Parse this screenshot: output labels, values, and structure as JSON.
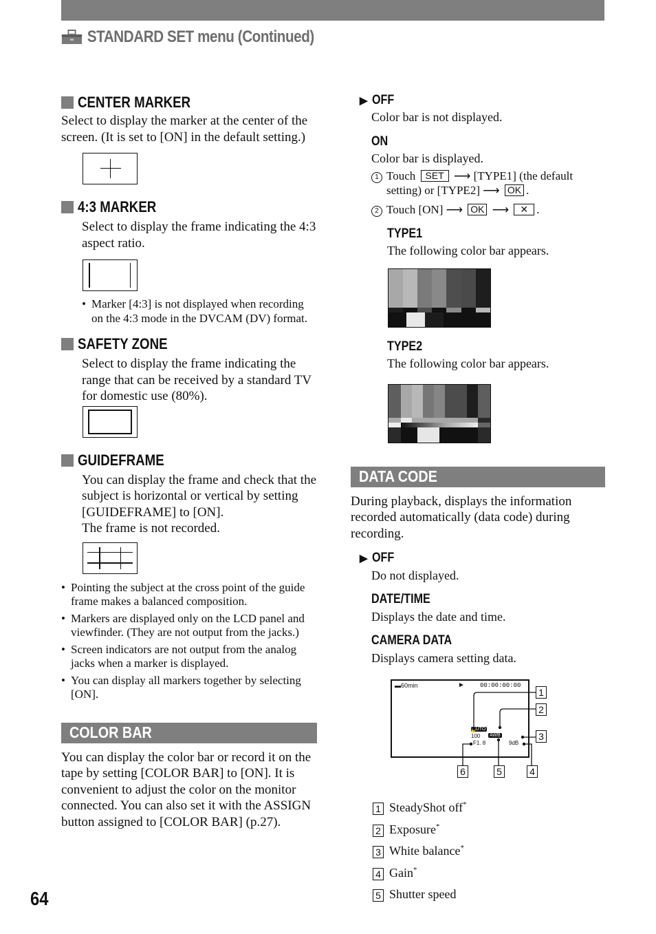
{
  "header": {
    "title": "STANDARD SET menu (Continued)",
    "icon": "toolbox-icon"
  },
  "page_number": "64",
  "left": {
    "center_marker": {
      "heading": "CENTER MARKER",
      "text": "Select to display the marker at the center of the screen. (It is set to [ON] in the default setting.)"
    },
    "marker_43": {
      "heading": "4:3 MARKER",
      "text": "Select to display the frame indicating the 4:3 aspect ratio.",
      "note": "Marker [4:3] is not displayed when recording on the 4:3 mode in the DVCAM (DV) format."
    },
    "safety_zone": {
      "heading": "SAFETY ZONE",
      "text": "Select to display the frame indicating the range that can be received by a standard TV for domestic use (80%)."
    },
    "guideframe": {
      "heading": "GUIDEFRAME",
      "text1": "You can display the frame and check that the subject is horizontal or vertical by setting [GUIDEFRAME] to [ON].",
      "text2": "The frame is not recorded.",
      "notes": [
        "Pointing the subject at the cross point of the guide frame makes a balanced composition.",
        "Markers are displayed only on the LCD panel and viewfinder. (They are not output from the jacks.)",
        "Screen indicators are not output from the analog jacks when a marker is displayed.",
        "You can display all markers together by selecting [ON]."
      ]
    },
    "color_bar": {
      "heading": "COLOR BAR",
      "text": "You can display the color bar or record it on the tape by setting [COLOR BAR] to [ON]. It is convenient to adjust the color on the monitor connected. You can also set it with the ASSIGN button assigned to [COLOR BAR] (p.27)."
    }
  },
  "right": {
    "off": {
      "label": "OFF",
      "desc": "Color bar is not displayed."
    },
    "on": {
      "label": "ON",
      "desc": "Color bar is displayed.",
      "step1": {
        "num": "1",
        "a": "Touch",
        "btn": "SET",
        "b": "[TYPE1] (the default",
        "c": "setting) or [TYPE2]",
        "ok": "OK"
      },
      "step2": {
        "num": "2",
        "a": "Touch [ON]",
        "ok": "OK",
        "close": "✕"
      }
    },
    "type1": {
      "label": "TYPE1",
      "desc": "The following color bar appears."
    },
    "type2": {
      "label": "TYPE2",
      "desc": "The following color bar appears."
    },
    "data_code": {
      "heading": "DATA CODE",
      "text": "During playback, displays the information recorded automatically (data code) during recording.",
      "off": {
        "label": "OFF",
        "desc": "Do not displayed."
      },
      "datetime": {
        "label": "DATE/TIME",
        "desc": "Displays the date and time."
      },
      "camera": {
        "label": "CAMERA DATA",
        "desc": "Displays camera setting data."
      }
    },
    "screen": {
      "battery": "60min",
      "timecode": "00:00:00:00",
      "exposure": "AUTO",
      "shutter": "100",
      "wb": "AWB",
      "iris": "F1. 8",
      "gain": "9dB",
      "callouts": [
        "1",
        "2",
        "3",
        "4",
        "5",
        "6"
      ]
    },
    "legend": [
      {
        "num": "1",
        "text": "SteadyShot off",
        "star": "*"
      },
      {
        "num": "2",
        "text": "Exposure",
        "star": "*"
      },
      {
        "num": "3",
        "text": "White balance",
        "star": "*"
      },
      {
        "num": "4",
        "text": "Gain",
        "star": "*"
      },
      {
        "num": "5",
        "text": "Shutter speed",
        "star": ""
      }
    ]
  }
}
